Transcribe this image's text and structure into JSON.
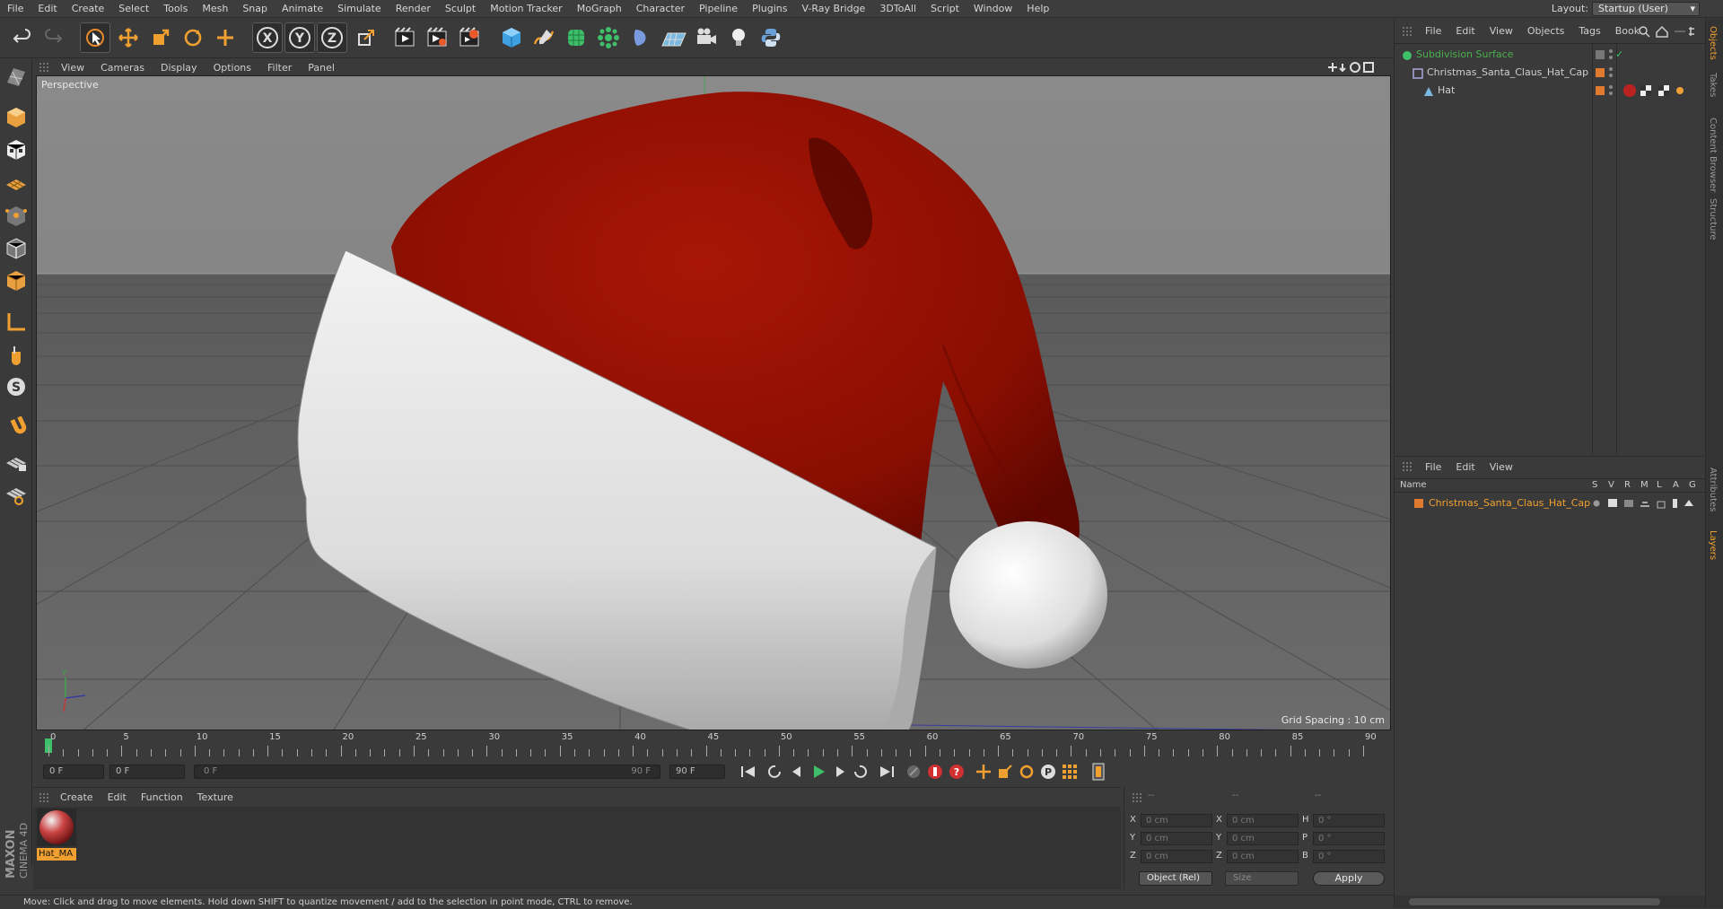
{
  "menubar": {
    "items": [
      "File",
      "Edit",
      "Create",
      "Select",
      "Tools",
      "Mesh",
      "Snap",
      "Animate",
      "Simulate",
      "Render",
      "Sculpt",
      "Motion Tracker",
      "MoGraph",
      "Character",
      "Pipeline",
      "Plugins",
      "V-Ray Bridge",
      "3DToAll",
      "Script",
      "Window",
      "Help"
    ],
    "layout_label": "Layout:",
    "layout_value": "Startup (User)"
  },
  "toolbar": {
    "icons": [
      "undo-icon",
      "redo-icon",
      "select-arrow-icon",
      "move-icon",
      "scale-icon",
      "rotate-icon",
      "add-move-icon",
      "x-axis-icon",
      "y-axis-icon",
      "z-axis-icon",
      "coordinate-system-icon",
      "render-view-icon",
      "render-picture-viewer-icon",
      "render-settings-icon",
      "cube-primitive-icon",
      "pen-spline-icon",
      "subdivision-nurbs-icon",
      "array-mograph-icon",
      "deformer-icon",
      "floor-scene-icon",
      "camera-icon",
      "light-icon",
      "python-icon"
    ]
  },
  "viewport": {
    "menu": [
      "View",
      "Cameras",
      "Display",
      "Options",
      "Filter",
      "Panel"
    ],
    "label": "Perspective",
    "grid_spacing": "Grid Spacing : 10 cm"
  },
  "timeline": {
    "ticks": [
      "0",
      "5",
      "10",
      "15",
      "20",
      "25",
      "30",
      "35",
      "40",
      "45",
      "50",
      "55",
      "60",
      "65",
      "70",
      "75",
      "80",
      "85",
      "90"
    ],
    "current_frame": "0 F",
    "start_frame": "0 F",
    "range_start": "0 F",
    "range_end": "90 F",
    "end_frame": "90 F"
  },
  "materials": {
    "menu": [
      "Create",
      "Edit",
      "Function",
      "Texture"
    ],
    "items": [
      {
        "name": "Hat_MA"
      }
    ]
  },
  "coordinates": {
    "headers": [
      "--",
      "--",
      "--"
    ],
    "rows": [
      {
        "a": "X",
        "av": "0 cm",
        "b": "X",
        "bv": "0 cm",
        "c": "H",
        "cv": "0 °"
      },
      {
        "a": "Y",
        "av": "0 cm",
        "b": "Y",
        "bv": "0 cm",
        "c": "P",
        "cv": "0 °"
      },
      {
        "a": "Z",
        "av": "0 cm",
        "b": "Z",
        "bv": "0 cm",
        "c": "B",
        "cv": "0 °"
      }
    ],
    "mode": "Object (Rel)",
    "size_mode": "Size",
    "apply": "Apply"
  },
  "object_manager": {
    "menu": [
      "File",
      "Edit",
      "View",
      "Objects",
      "Tags",
      "Book"
    ],
    "objects": [
      {
        "name": "Subdivision Surface",
        "indent": 0,
        "color": "#4caf50"
      },
      {
        "name": "Christmas_Santa_Claus_Hat_Cap",
        "indent": 1,
        "color": "#cfcfcf"
      },
      {
        "name": "Hat",
        "indent": 2,
        "color": "#cfcfcf"
      }
    ]
  },
  "layer_manager": {
    "menu": [
      "File",
      "Edit",
      "View"
    ],
    "header_name": "Name",
    "columns": [
      "S",
      "V",
      "R",
      "M",
      "L",
      "A",
      "G"
    ],
    "layers": [
      {
        "name": "Christmas_Santa_Claus_Hat_Cap",
        "color": "#e07a2f"
      }
    ]
  },
  "side_tabs": [
    "Objects",
    "Takes",
    "Content Browser",
    "Structure",
    "Attributes",
    "Layers"
  ],
  "branding": {
    "maxon": "MAXON",
    "product": "CINEMA 4D"
  },
  "status": "Move: Click and drag to move elements. Hold down SHIFT to quantize movement / add to the selection in point mode, CTRL to remove.",
  "colors": {
    "accent": "#f0a030",
    "bg": "#3a3a3a",
    "hat_red": "#9a1005",
    "layer_orange": "#e07a2f"
  }
}
